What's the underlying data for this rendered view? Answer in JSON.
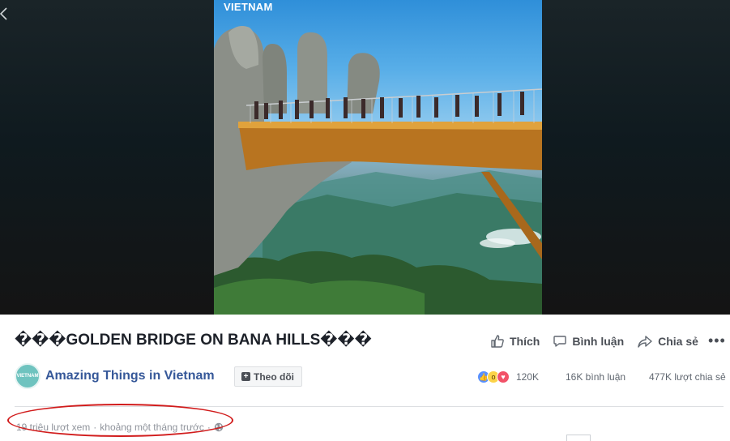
{
  "video": {
    "watermark": "VIETNAM"
  },
  "post": {
    "title": "���GOLDEN BRIDGE ON BANA HILLS���",
    "actions": {
      "like": "Thích",
      "comment": "Bình luận",
      "share": "Chia sẻ"
    },
    "page": {
      "name": "Amazing Things in Vietnam",
      "avatar_text": "VIETNAM",
      "follow_label": "Theo dõi"
    },
    "stats": {
      "reactions_count": "120K",
      "comments": "16K bình luận",
      "shares": "477K lượt chia sẻ"
    },
    "meta": {
      "views": "19 triệu lượt xem",
      "separator": "·",
      "time": "khoảng một tháng trước"
    }
  },
  "colors": {
    "link": "#365899",
    "highlight": "#d11c1c",
    "like_reaction": "#5890ff",
    "love_reaction": "#f25268",
    "wow_reaction": "#fcd348"
  },
  "icons": [
    "back-arrow-icon",
    "like-icon",
    "comment-icon",
    "share-icon",
    "more-icon",
    "plus-icon",
    "globe-icon"
  ]
}
